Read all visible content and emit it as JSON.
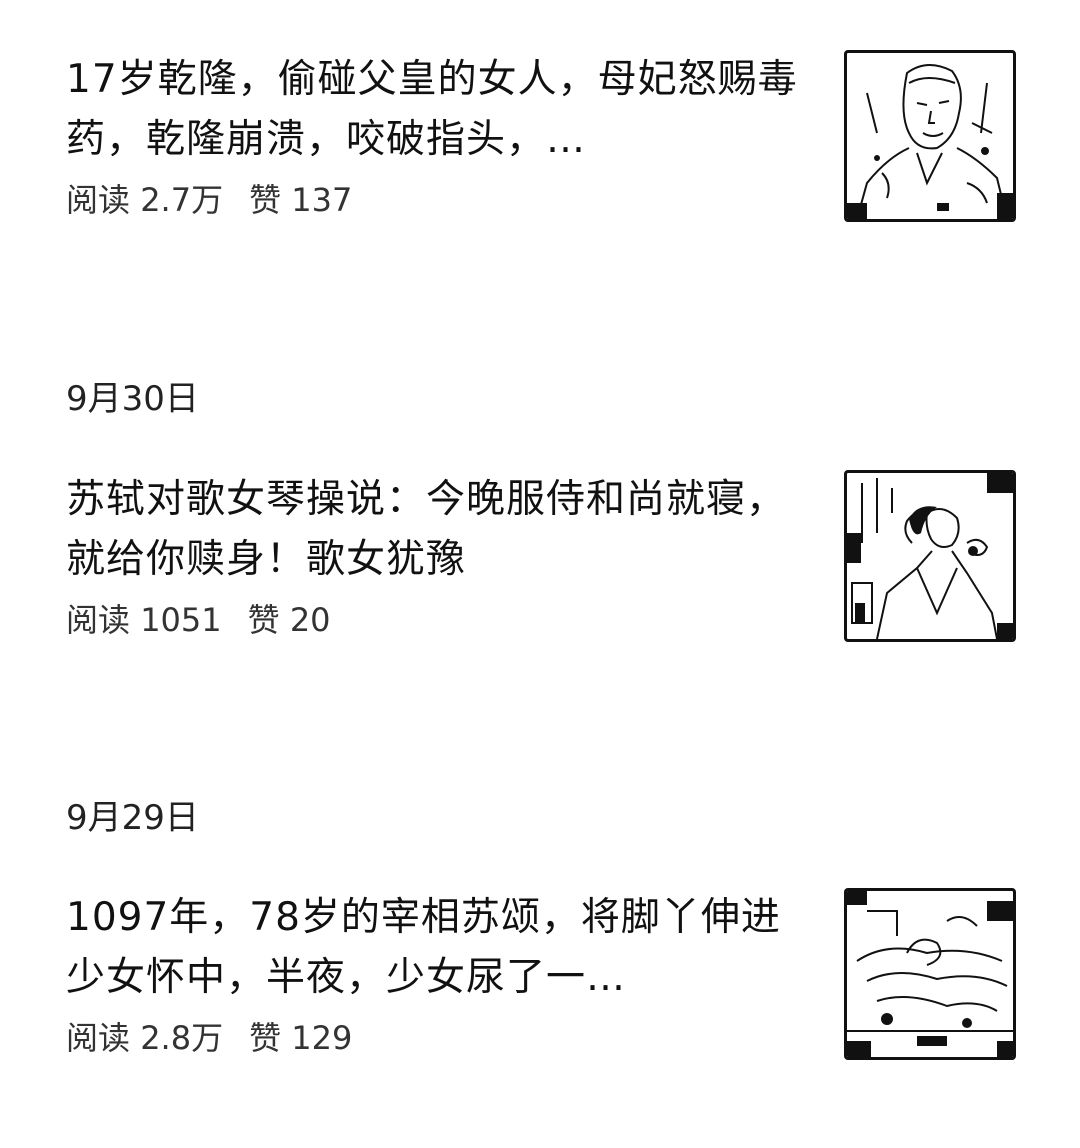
{
  "articles": [
    {
      "title": "17岁乾隆，偷碰父皇的女人，母妃怒赐毒药，乾隆崩溃，咬破指头，…",
      "reads_label": "阅读",
      "reads": "2.7万",
      "likes_label": "赞",
      "likes": "137"
    },
    {
      "date": "9月30日",
      "title": "苏轼对歌女琴操说：今晚服侍和尚就寝，就给你赎身！歌女犹豫",
      "reads_label": "阅读",
      "reads": "1051",
      "likes_label": "赞",
      "likes": "20"
    },
    {
      "date": "9月29日",
      "title": "1097年，78岁的宰相苏颂，将脚丫伸进少女怀中，半夜，少女尿了一…",
      "reads_label": "阅读",
      "reads": "2.8万",
      "likes_label": "赞",
      "likes": "129"
    }
  ]
}
